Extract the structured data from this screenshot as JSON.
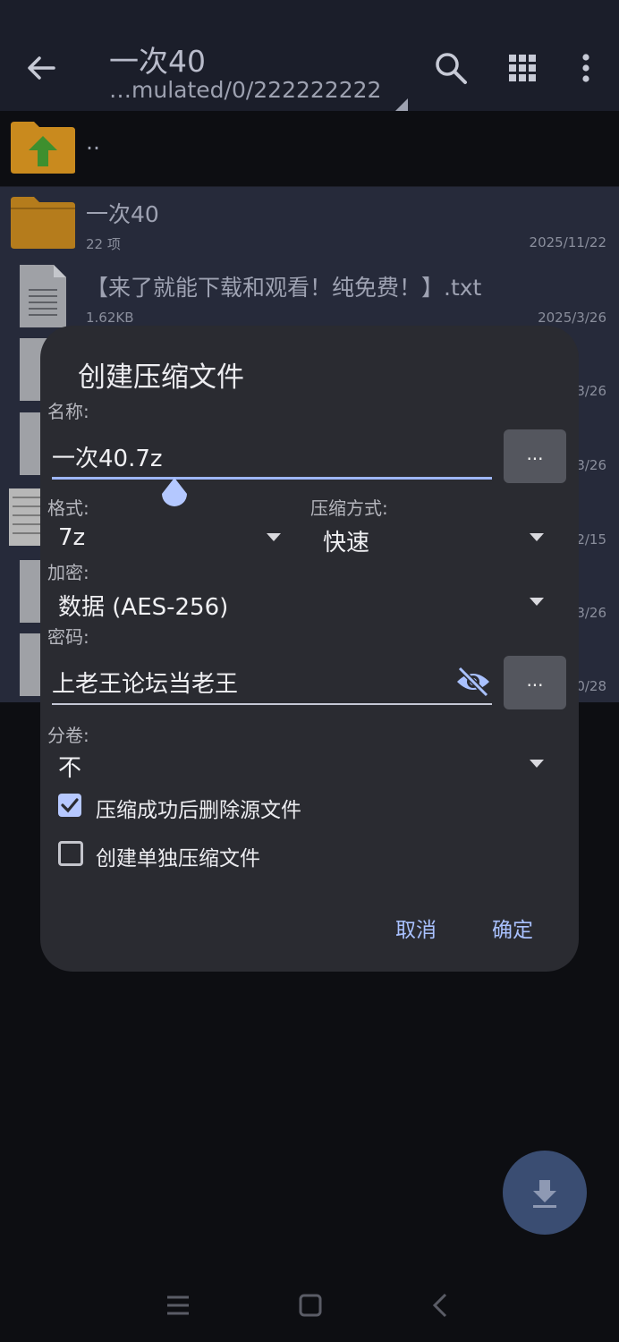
{
  "appbar": {
    "title": "一次40",
    "path": "…mulated/0/222222222"
  },
  "parent_row": {
    "name": ".."
  },
  "files": [
    {
      "name": "一次40",
      "meta": "22 项",
      "date": "2025/11/22",
      "kind": "folder"
    },
    {
      "name": "【来了就能下载和观看！纯免费！】.txt",
      "meta": "1.62KB",
      "date": "2025/3/26",
      "kind": "doc"
    },
    {
      "date": "3/26",
      "kind": "doc"
    },
    {
      "date": "3/26",
      "kind": "doc"
    },
    {
      "date": "2/15",
      "kind": "image"
    },
    {
      "date": "3/26",
      "kind": "doc"
    },
    {
      "date": "0/28",
      "kind": "doc"
    }
  ],
  "dialog": {
    "title": "创建压缩文件",
    "name_label": "名称:",
    "name_value": "一次40.7z",
    "more_button": "...",
    "format_label": "格式:",
    "format_value": "7z",
    "method_label": "压缩方式:",
    "method_value": "快速",
    "encrypt_label": "加密:",
    "encrypt_value": "数据 (AES-256)",
    "password_label": "密码:",
    "password_value": "上老王论坛当老王",
    "split_label": "分卷:",
    "split_value": "不",
    "delete_source_label": "压缩成功后删除源文件",
    "delete_source_checked": true,
    "separate_label": "创建单独压缩文件",
    "separate_checked": false,
    "cancel_label": "取消",
    "ok_label": "确定"
  },
  "colors": {
    "accent": "#a9c1ff",
    "folder": "#c98a1e",
    "dialog_bg": "#2a2b31"
  }
}
